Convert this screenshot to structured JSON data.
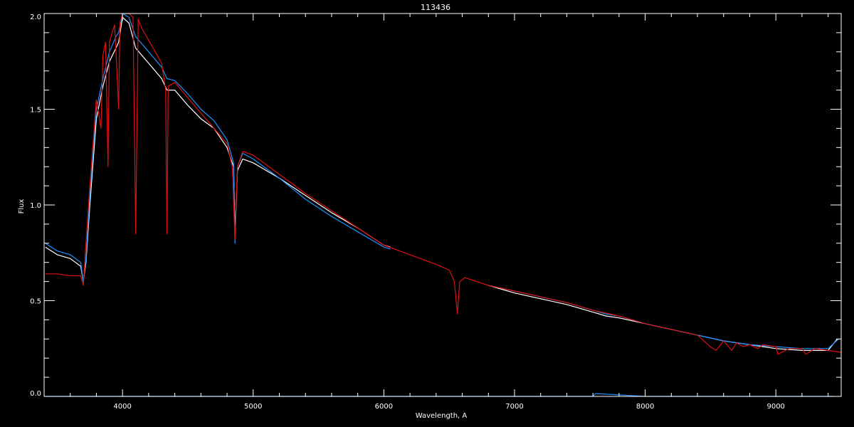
{
  "chart_data": {
    "type": "line",
    "title": "113436",
    "xlabel": "Wavelength, A",
    "ylabel": "Flux",
    "xlim": [
      3400,
      9500
    ],
    "ylim": [
      0.0,
      2.0
    ],
    "xticks": [
      4000,
      5000,
      6000,
      7000,
      8000,
      9000
    ],
    "xtick_labels": [
      "4000",
      "5000",
      "6000",
      "7000",
      "8000",
      "9000"
    ],
    "yticks": [
      0.0,
      0.5,
      1.0,
      1.5,
      2.0
    ],
    "ytick_labels": [
      "0.0",
      "0.5",
      "1.0",
      "1.5",
      "2.0"
    ],
    "grid": false,
    "legend": "none",
    "background": "#000000",
    "axis_color": "#ffffff",
    "series": [
      {
        "color": "#ffffff",
        "x": [
          3410,
          3500,
          3600,
          3680,
          3700,
          3720,
          3750,
          3800,
          3850,
          3900,
          3950,
          3970,
          4000,
          4050,
          4100,
          4150,
          4200,
          4250,
          4300,
          4340,
          4400,
          4500,
          4600,
          4700,
          4800,
          4850,
          4861,
          4880,
          4920,
          5000,
          5200,
          5400,
          5600,
          5800,
          6000,
          6050
        ],
        "y": [
          0.78,
          0.74,
          0.72,
          0.68,
          0.6,
          0.7,
          1.0,
          1.45,
          1.62,
          1.75,
          1.82,
          1.85,
          1.98,
          1.95,
          1.82,
          1.78,
          1.74,
          1.7,
          1.66,
          1.6,
          1.6,
          1.52,
          1.45,
          1.4,
          1.3,
          1.2,
          0.86,
          1.18,
          1.24,
          1.22,
          1.14,
          1.05,
          0.96,
          0.88,
          0.79,
          0.78
        ]
      },
      {
        "color": "#ffffff",
        "x": [
          6800,
          7000,
          7200,
          7400,
          7600,
          7700,
          7800,
          8000,
          8200,
          8400,
          8600,
          8800,
          9000,
          9200,
          9400,
          9470
        ],
        "y": [
          0.58,
          0.54,
          0.51,
          0.48,
          0.44,
          0.42,
          0.41,
          0.38,
          0.35,
          0.32,
          0.29,
          0.27,
          0.25,
          0.24,
          0.24,
          0.3
        ]
      },
      {
        "color": "#1e90ff",
        "x": [
          3410,
          3500,
          3600,
          3680,
          3700,
          3720,
          3750,
          3800,
          3850,
          3900,
          3950,
          3970,
          4000,
          4050,
          4100,
          4150,
          4200,
          4250,
          4300,
          4340,
          4400,
          4500,
          4600,
          4700,
          4800,
          4850,
          4861,
          4880,
          4920,
          5000,
          5200,
          5400,
          5600,
          5800,
          6000,
          6050
        ],
        "y": [
          0.8,
          0.76,
          0.74,
          0.7,
          0.6,
          0.72,
          1.05,
          1.5,
          1.66,
          1.8,
          1.88,
          1.9,
          2.0,
          1.98,
          1.88,
          1.84,
          1.8,
          1.76,
          1.72,
          1.66,
          1.65,
          1.58,
          1.5,
          1.44,
          1.34,
          1.22,
          0.8,
          1.2,
          1.27,
          1.24,
          1.14,
          1.03,
          0.94,
          0.86,
          0.78,
          0.77
        ]
      },
      {
        "color": "#1e90ff",
        "x": [
          6800,
          7000,
          7200,
          7400,
          7600,
          7700,
          7800,
          8000,
          8200,
          8400,
          8600,
          8800,
          9000,
          9200,
          9400,
          9480
        ],
        "y": [
          0.58,
          0.55,
          0.52,
          0.49,
          0.45,
          0.43,
          0.42,
          0.38,
          0.35,
          0.32,
          0.29,
          0.27,
          0.26,
          0.25,
          0.25,
          0.3
        ]
      },
      {
        "color": "#1e90ff",
        "x": [
          3410,
          4000,
          5000,
          6000,
          7000,
          7600,
          7620,
          8000,
          9000,
          9450
        ],
        "y": [
          0.0,
          0.0,
          0.0,
          0.0,
          0.0,
          0.0,
          0.015,
          0.0,
          0.0,
          0.0
        ]
      },
      {
        "color": "#dd1111",
        "x": [
          3410,
          3500,
          3600,
          3680,
          3700,
          3720,
          3750,
          3800,
          3835,
          3850,
          3870,
          3889,
          3900,
          3920,
          3940,
          3950,
          3970,
          3980,
          4000,
          4050,
          4080,
          4101,
          4120,
          4150,
          4200,
          4250,
          4300,
          4330,
          4340,
          4350,
          4400,
          4500,
          4600,
          4700,
          4800,
          4840,
          4861,
          4880,
          4920,
          5000,
          5200,
          5400,
          5600,
          5800,
          6000,
          6200,
          6400,
          6500,
          6540,
          6563,
          6580,
          6620,
          6800,
          7000,
          7200,
          7400,
          7600,
          7800,
          8000,
          8200,
          8400,
          8498,
          8542,
          8600,
          8662,
          8700,
          8750,
          8800,
          8863,
          8900,
          9000,
          9015,
          9100,
          9200,
          9229,
          9300,
          9400,
          9500
        ],
        "y": [
          0.64,
          0.64,
          0.63,
          0.63,
          0.58,
          0.8,
          1.1,
          1.55,
          1.4,
          1.78,
          1.85,
          1.2,
          1.85,
          1.9,
          1.94,
          1.8,
          1.5,
          1.95,
          2.0,
          2.0,
          1.98,
          0.85,
          1.97,
          1.92,
          1.86,
          1.8,
          1.74,
          1.6,
          0.85,
          1.62,
          1.64,
          1.56,
          1.48,
          1.4,
          1.32,
          1.2,
          0.82,
          1.2,
          1.28,
          1.26,
          1.16,
          1.06,
          0.97,
          0.88,
          0.79,
          0.74,
          0.69,
          0.66,
          0.6,
          0.43,
          0.6,
          0.62,
          0.58,
          0.55,
          0.52,
          0.49,
          0.45,
          0.42,
          0.38,
          0.35,
          0.32,
          0.26,
          0.24,
          0.29,
          0.24,
          0.28,
          0.26,
          0.27,
          0.25,
          0.27,
          0.26,
          0.22,
          0.25,
          0.25,
          0.22,
          0.25,
          0.24,
          0.23
        ]
      }
    ]
  }
}
